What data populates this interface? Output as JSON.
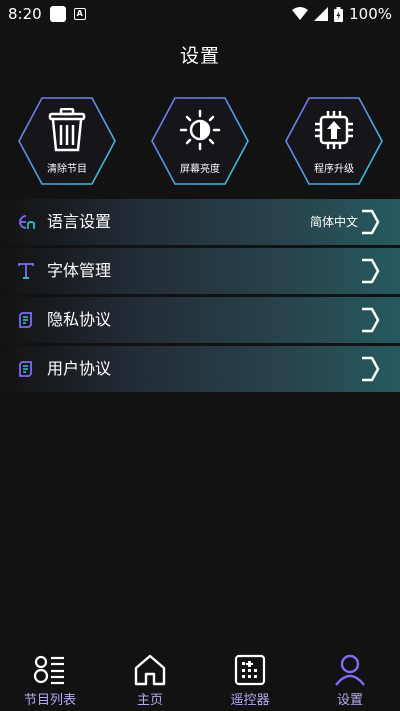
{
  "status_bar": {
    "time": "8:20",
    "battery": "100%"
  },
  "page": {
    "title": "设置"
  },
  "actions": [
    {
      "label": "清除节目",
      "icon": "trash-icon"
    },
    {
      "label": "屏幕亮度",
      "icon": "brightness-icon"
    },
    {
      "label": "程序升级",
      "icon": "upgrade-chip-icon"
    }
  ],
  "settings": [
    {
      "label": "语言设置",
      "value": "简体中文",
      "icon": "language-icon"
    },
    {
      "label": "字体管理",
      "value": "",
      "icon": "font-icon"
    },
    {
      "label": "隐私协议",
      "value": "",
      "icon": "document-icon"
    },
    {
      "label": "用户协议",
      "value": "",
      "icon": "document-icon"
    }
  ],
  "nav": [
    {
      "label": "节目列表",
      "icon": "program-list-icon"
    },
    {
      "label": "主页",
      "icon": "home-icon"
    },
    {
      "label": "遥控器",
      "icon": "remote-control-icon"
    },
    {
      "label": "设置",
      "icon": "user-settings-icon"
    }
  ],
  "colors": {
    "background": "#121212",
    "accent_cyan": "#2ec9d6",
    "accent_purple": "#7d6cf2",
    "nav_label": "#b9a8f5"
  }
}
